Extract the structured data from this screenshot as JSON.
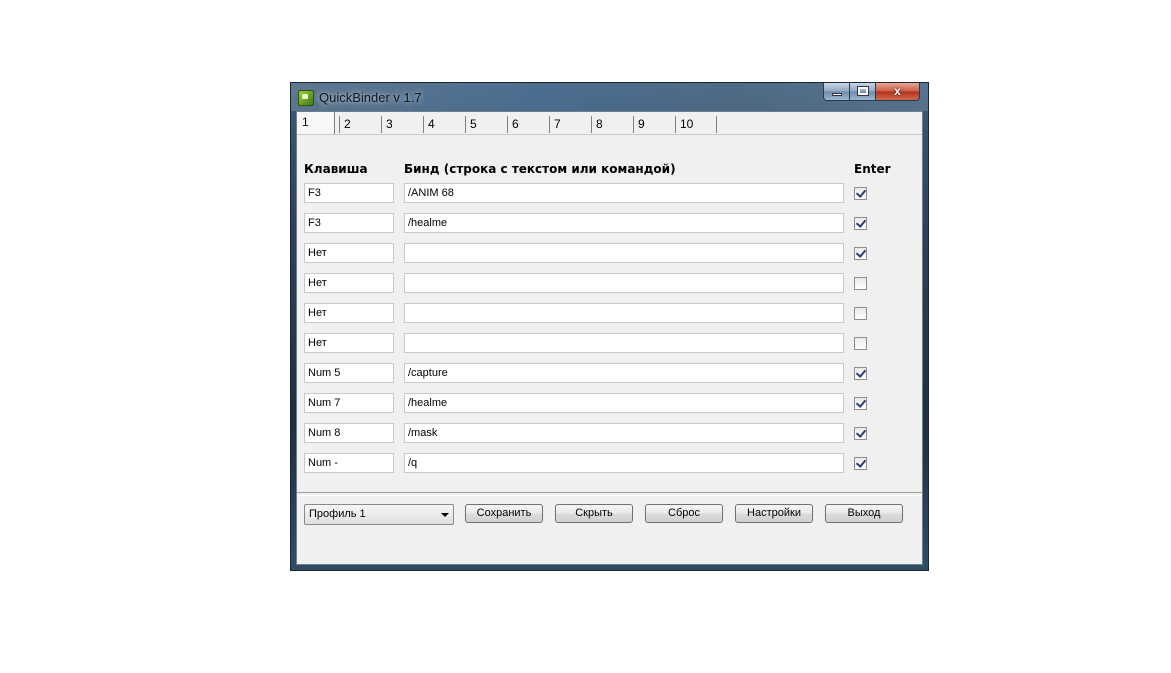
{
  "window": {
    "title": "QuickBinder v 1.7",
    "close_glyph": "x"
  },
  "tabs": [
    "1",
    "2",
    "3",
    "4",
    "5",
    "6",
    "7",
    "8",
    "9",
    "10"
  ],
  "headers": {
    "key": "Клавиша",
    "bind": "Бинд (строка с текстом или командой)",
    "enter": "Enter"
  },
  "rows": [
    {
      "key": "F3",
      "bind": "/ANIM 68",
      "enter": true
    },
    {
      "key": "F3",
      "bind": "/healme",
      "enter": true
    },
    {
      "key": "Нет",
      "bind": "",
      "enter": true
    },
    {
      "key": "Нет",
      "bind": "",
      "enter": false
    },
    {
      "key": "Нет",
      "bind": "",
      "enter": false
    },
    {
      "key": "Нет",
      "bind": "",
      "enter": false
    },
    {
      "key": "Num 5",
      "bind": "/capture",
      "enter": true
    },
    {
      "key": "Num 7",
      "bind": "/healme",
      "enter": true
    },
    {
      "key": "Num 8",
      "bind": "/mask",
      "enter": true
    },
    {
      "key": "Num -",
      "bind": "/q",
      "enter": true
    }
  ],
  "footer": {
    "profile_selected": "Профиль 1",
    "save": "Сохранить",
    "hide": "Скрыть",
    "reset": "Сброс",
    "settings": "Настройки",
    "exit": "Выход"
  },
  "icons": {
    "app": "app-icon",
    "minimize": "minimize-icon",
    "maximize": "maximize-icon",
    "close": "close-icon",
    "dropdown": "chevron-down-icon"
  },
  "colors": {
    "client_bg": "#f0f0f0",
    "check_color": "#2a3f7a",
    "close_button": "#c85b45"
  }
}
